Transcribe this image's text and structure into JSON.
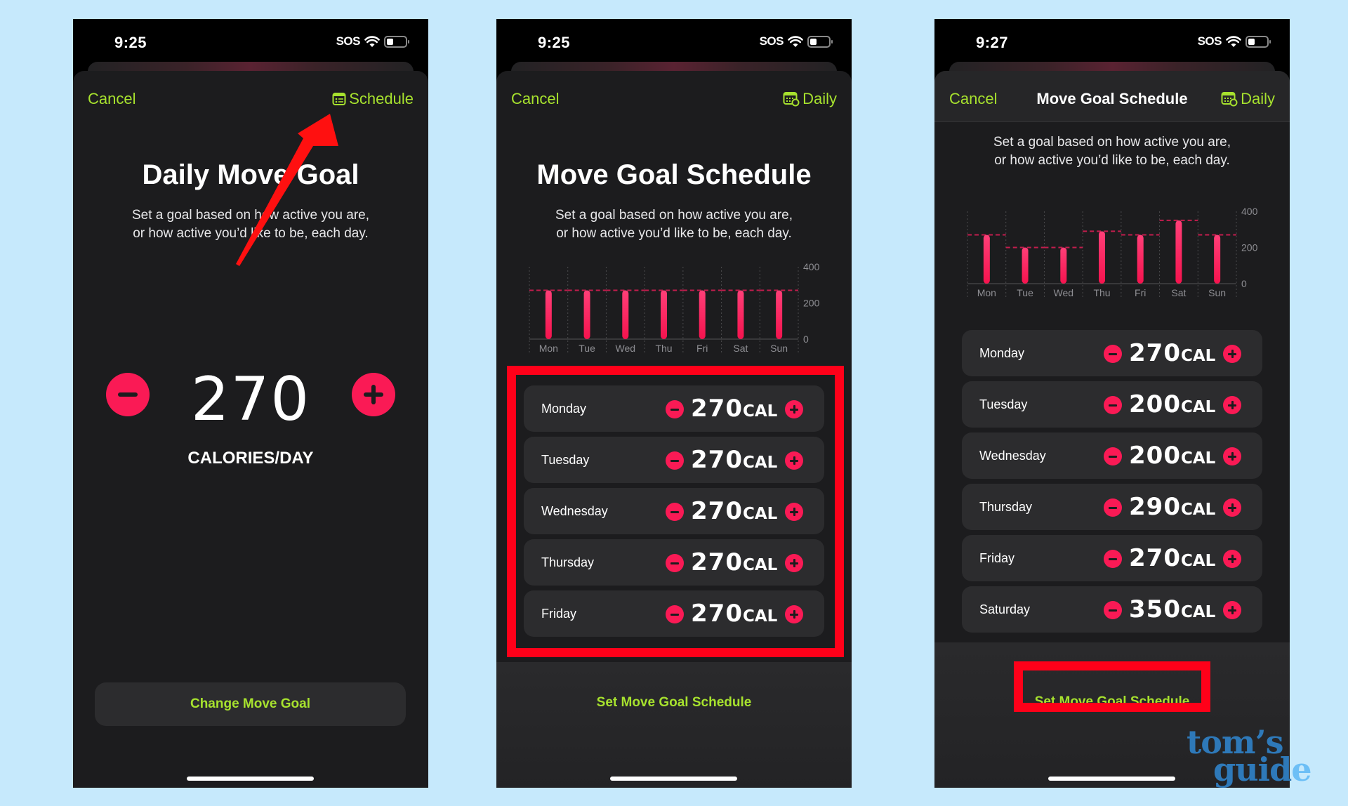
{
  "colors": {
    "background": "#c6e9fc",
    "accent_green": "#a7e22e",
    "move_red": "#fa1a55",
    "annotation_red": "#ff0019",
    "sheet": "#1c1c1e",
    "row": "#2c2c2e"
  },
  "screens": [
    {
      "status": {
        "time": "9:25",
        "sos": "SOS",
        "wifi_icon": "wifi-icon",
        "battery_icon": "battery-low-icon"
      },
      "nav": {
        "cancel": "Cancel",
        "action_label": "Schedule",
        "action_icon": "list-calendar-icon"
      },
      "title": "Daily Move Goal",
      "subtitle_line1": "Set a goal based on how active you are,",
      "subtitle_line2": "or how active you’d like to be, each day.",
      "goal_value": "270",
      "goal_unit": "CALORIES/DAY",
      "button": "Change Move Goal"
    },
    {
      "status": {
        "time": "9:25",
        "sos": "SOS",
        "wifi_icon": "wifi-icon",
        "battery_icon": "battery-low-icon"
      },
      "nav": {
        "cancel": "Cancel",
        "action_label": "Daily",
        "action_icon": "calendar-clock-icon"
      },
      "title": "Move Goal Schedule",
      "subtitle_line1": "Set a goal based on how active you are,",
      "subtitle_line2": "or how active you’d like to be, each day.",
      "rows": [
        {
          "day": "Monday",
          "value": "270",
          "unit": "CAL"
        },
        {
          "day": "Tuesday",
          "value": "270",
          "unit": "CAL"
        },
        {
          "day": "Wednesday",
          "value": "270",
          "unit": "CAL"
        },
        {
          "day": "Thursday",
          "value": "270",
          "unit": "CAL"
        },
        {
          "day": "Friday",
          "value": "270",
          "unit": "CAL"
        }
      ],
      "button": "Set Move Goal Schedule"
    },
    {
      "status": {
        "time": "9:27",
        "sos": "SOS",
        "wifi_icon": "wifi-icon",
        "battery_icon": "battery-low-icon"
      },
      "nav": {
        "cancel": "Cancel",
        "title": "Move Goal Schedule",
        "action_label": "Daily",
        "action_icon": "calendar-clock-icon"
      },
      "subtitle_line1": "Set a goal based on how active you are,",
      "subtitle_line2": "or how active you’d like to be, each day.",
      "rows": [
        {
          "day": "Monday",
          "value": "270",
          "unit": "CAL"
        },
        {
          "day": "Tuesday",
          "value": "200",
          "unit": "CAL"
        },
        {
          "day": "Wednesday",
          "value": "200",
          "unit": "CAL"
        },
        {
          "day": "Thursday",
          "value": "290",
          "unit": "CAL"
        },
        {
          "day": "Friday",
          "value": "270",
          "unit": "CAL"
        },
        {
          "day": "Saturday",
          "value": "350",
          "unit": "CAL"
        }
      ],
      "button": "Set Move Goal Schedule"
    }
  ],
  "chart_data": [
    {
      "type": "bar",
      "title": "",
      "categories": [
        "Mon",
        "Tue",
        "Wed",
        "Thu",
        "Fri",
        "Sat",
        "Sun"
      ],
      "values": [
        270,
        270,
        270,
        270,
        270,
        270,
        270
      ],
      "goal_lines": [
        270,
        270,
        270,
        270,
        270,
        270,
        270
      ],
      "yticks": [
        "400",
        "200",
        "0"
      ],
      "ylim": [
        0,
        400
      ],
      "xlabel": "",
      "ylabel": "",
      "grid": true
    },
    {
      "type": "bar",
      "title": "",
      "categories": [
        "Mon",
        "Tue",
        "Wed",
        "Thu",
        "Fri",
        "Sat",
        "Sun"
      ],
      "values": [
        270,
        200,
        200,
        290,
        270,
        350,
        270
      ],
      "goal_lines": [
        270,
        200,
        200,
        290,
        270,
        350,
        270
      ],
      "yticks": [
        "400",
        "200",
        "0"
      ],
      "ylim": [
        0,
        400
      ],
      "xlabel": "",
      "ylabel": "",
      "grid": true
    }
  ],
  "watermark": {
    "line1": "tom’s",
    "line2_dark": "guid",
    "line2_light": "e"
  }
}
